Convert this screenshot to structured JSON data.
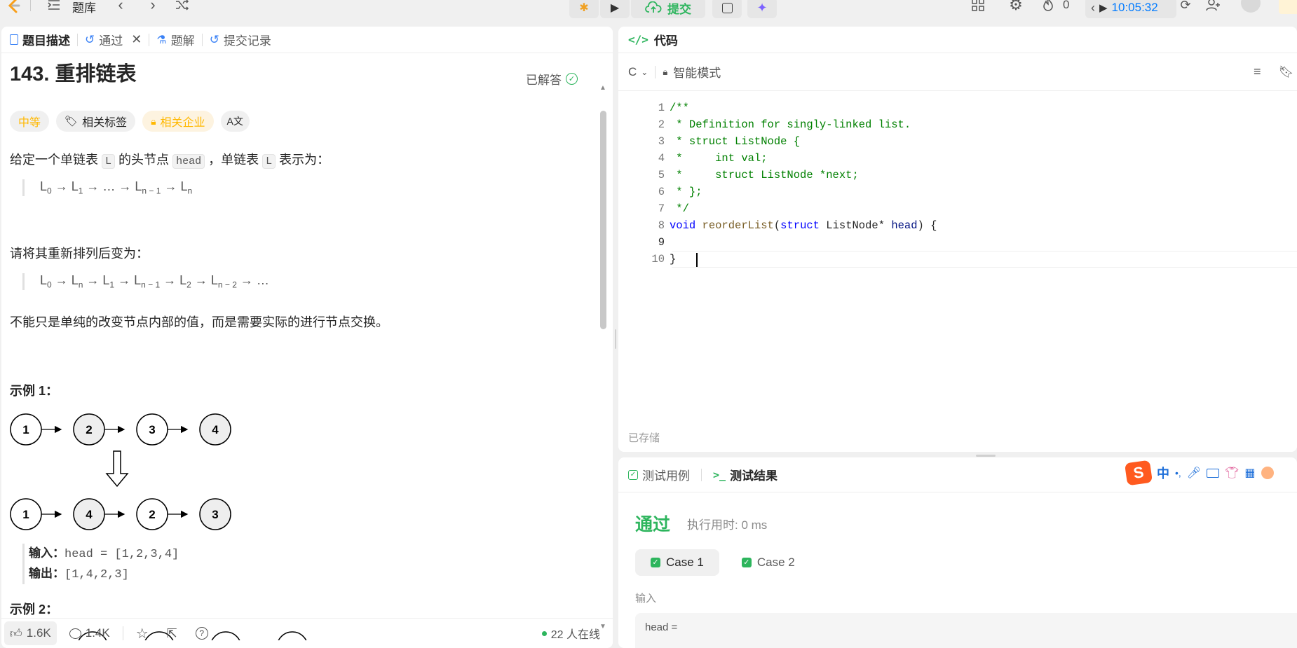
{
  "topbar": {
    "problem_bank": "题库",
    "submit": "提交",
    "streak_count": "0",
    "timer": "10:05:32"
  },
  "left_tabs": {
    "description": "题目描述",
    "passed": "通过",
    "solutions": "题解",
    "submissions": "提交记录"
  },
  "problem": {
    "title": "143. 重排链表",
    "solved_status": "已解答",
    "difficulty": "中等",
    "tags_label": "相关标签",
    "companies_label": "相关企业",
    "translate_label": "A文",
    "intro_a": "给定一个单链表",
    "intro_L": "L",
    "intro_b": "的头节点",
    "intro_head": "head",
    "intro_c": "，单链表",
    "intro_L2": "L",
    "intro_d": "表示为：",
    "reorder_prompt": "请将其重新排列后变为：",
    "note": "不能只是单纯的改变节点内部的值，而是需要实际的进行节点交换。",
    "example1_title": "示例 1：",
    "example1_input_label": "输入：",
    "example1_input": "head = [1,2,3,4]",
    "example1_output_label": "输出：",
    "example1_output": "[1,4,2,3]",
    "example2_title": "示例 2：",
    "diagram_top": [
      "1",
      "2",
      "3",
      "4"
    ],
    "diagram_bottom": [
      "1",
      "4",
      "2",
      "3"
    ]
  },
  "footer": {
    "likes": "1.6K",
    "comments": "1.4K",
    "online": "22 人在线"
  },
  "editor": {
    "title": "代码",
    "language": "C",
    "mode": "智能模式",
    "saved": "已存储",
    "line_numbers": [
      "1",
      "2",
      "3",
      "4",
      "5",
      "6",
      "7",
      "8",
      "9",
      "10"
    ],
    "lines": [
      "/**",
      " * Definition for singly-linked list.",
      " * struct ListNode {",
      " *     int val;",
      " *     struct ListNode *next;",
      " * };",
      " */",
      "void reorderList(struct ListNode* head) {",
      "    ",
      "}"
    ]
  },
  "result": {
    "tab_testcase": "测试用例",
    "tab_result": "测试结果",
    "status": "通过",
    "runtime": "执行用时: 0 ms",
    "case1": "Case 1",
    "case2": "Case 2",
    "input_label": "输入",
    "input_value": "head ="
  },
  "ime": {
    "zh": "中",
    "punct": "•,"
  },
  "colors": {
    "accent_green": "#2db55d",
    "difficulty_orange": "#ffb800",
    "submit_green": "#2db55d",
    "timer_blue": "#007aff"
  }
}
